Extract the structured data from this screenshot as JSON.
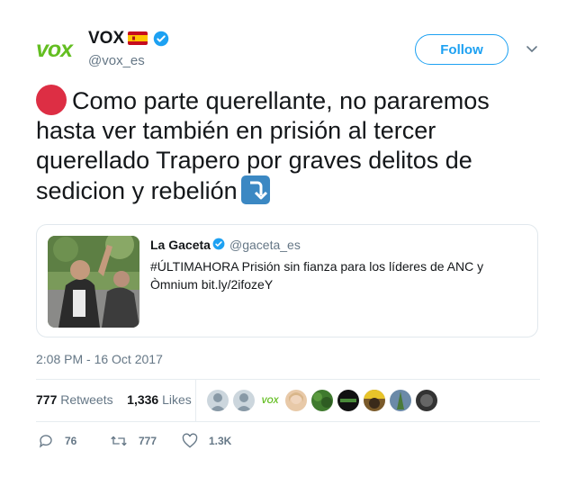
{
  "header": {
    "logo_text": "vox",
    "display_name": "VOX",
    "handle": "@vox_es",
    "follow_label": "Follow"
  },
  "tweet": {
    "text": "Como parte querellante, no pararemos hasta ver también en prisión al tercer querellado Trapero por graves delitos de sedicion y rebelión"
  },
  "quote": {
    "name": "La Gaceta",
    "handle": "@gaceta_es",
    "text": "#ÚLTIMAHORA Prisión sin fianza para los líderes de ANC y Òmnium bit.ly/2ifozeY"
  },
  "timestamp": "2:08 PM - 16 Oct 2017",
  "stats": {
    "retweets_count": "777",
    "retweets_label": "Retweets",
    "likes_count": "1,336",
    "likes_label": "Likes"
  },
  "likers_avatar_vox_text": "VOX",
  "actions": {
    "replies": "76",
    "retweets": "777",
    "likes": "1.3K"
  },
  "colors": {
    "accent": "#1da1f2",
    "vox_green": "#63be21",
    "red_circle": "#dd2e44",
    "muted": "#657786"
  },
  "icons": [
    "vox-logo",
    "spain-flag-icon",
    "verified-badge-icon",
    "chevron-down-icon",
    "red-circle-emoji",
    "arrow-down-emoji",
    "reply-icon",
    "retweet-icon",
    "like-icon"
  ]
}
